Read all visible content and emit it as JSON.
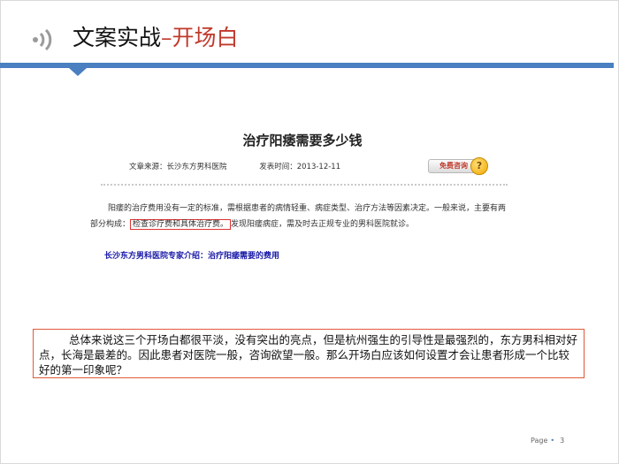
{
  "header": {
    "title": "文案实战",
    "separator": "–",
    "subtitle": "开场白"
  },
  "article": {
    "title": "治疗阳痿需要多少钱",
    "source": "文章来源：长沙东方男科医院",
    "publish_time": "发表时间：2013-12-11",
    "consult_label": "免费咨询",
    "consult_icon": "?",
    "body_before": "阳痿的治疗费用没有一定的标准，需根据患者的病情轻重、病症类型、治疗方法等因素决定。一般来说，主要有两部分构成：",
    "body_highlight": "检查诊疗费和具体治疗费。",
    "body_after": "发现阳痿病症，需及时去正规专业的男科医院就诊。",
    "link_text": "长沙东方男科医院专家介绍：治疗阳痿需要的费用"
  },
  "summary": {
    "text": "总体来说这三个开场白都很平淡，没有突出的亮点，但是杭州强生的引导性是最强烈的，东方男科相对好点，长海是最差的。因此患者对医院一般，咨询欲望一般。那么开场白应该如何设置才会让患者形成一个比较好的第一印象呢？"
  },
  "footer": {
    "page_label": "Page",
    "bullet": "•",
    "page_number": "3"
  },
  "colors": {
    "accent_blue": "#4a7fc1",
    "title_red": "#c0392b",
    "box_border": "#e05a3a",
    "link_blue": "#1a1aa8"
  }
}
